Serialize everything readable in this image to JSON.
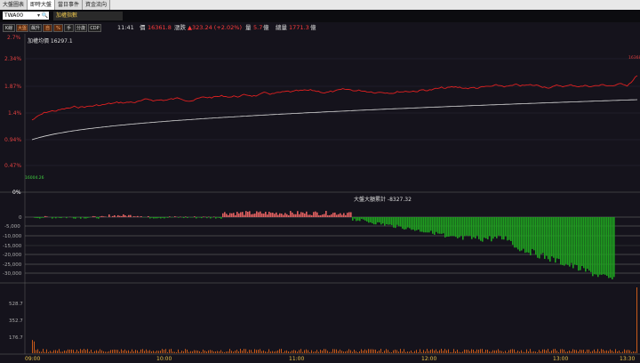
{
  "tabs": [
    "大盤圖表",
    "即時大盤",
    "當日事件",
    "資金流向"
  ],
  "active_tab": 1,
  "symbol_input": "TWA00",
  "symbol_name": "加權指數",
  "buttons": [
    "K線",
    "大盤",
    "飆升",
    "自",
    "%",
    "手",
    "分歲",
    "CDP"
  ],
  "quote": {
    "time": "11:41",
    "price_label": "價",
    "price": "16361.8",
    "change_label": "漲跌",
    "change": "▲323.24 (+2.02%)",
    "volume_label": "量",
    "volume": "5.7",
    "unit": "億",
    "total_label": "總量",
    "total": "1771.3"
  },
  "price_chart": {
    "title": "加權均價 16297.1",
    "y_labels": [
      "2.7%",
      "2.34%",
      "1.87%",
      "1.4%",
      "0.94%",
      "0.47%",
      "0%"
    ],
    "low_label": "16004.26",
    "high_label": "16368"
  },
  "flow_chart": {
    "title": "大盤大額累計 -8327.32",
    "y_labels": [
      "0",
      "-5,000",
      "-10,000",
      "-15,000",
      "-20,000",
      "-25,000",
      "-30,000"
    ]
  },
  "volume_chart": {
    "y_labels": [
      "528.7",
      "352.7",
      "176.7"
    ]
  },
  "time_labels": [
    "09:00",
    "10:00",
    "11:00",
    "12:00",
    "13:00",
    "13:30"
  ],
  "colors": {
    "up": "#e02020",
    "down": "#1fa01f",
    "avg": "#d8d8d8"
  }
}
